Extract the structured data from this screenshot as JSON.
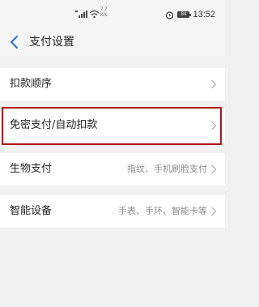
{
  "status_bar": {
    "net_speed_value": "7.7",
    "net_speed_unit": "K/s",
    "battery": "84",
    "time": "13:52"
  },
  "header": {
    "title": "支付设置"
  },
  "rows": [
    {
      "label": "扣款顺序",
      "value": ""
    },
    {
      "label": "免密支付/自动扣款",
      "value": ""
    },
    {
      "label": "生物支付",
      "value": "指纹、手机刷脸支付"
    },
    {
      "label": "智能设备",
      "value": "手表、手环、智能卡等"
    }
  ],
  "colors": {
    "highlight_border": "#b0161c",
    "page_background": "#f1f1f1",
    "row_background": "#ffffff"
  },
  "icons": [
    "back-arrow-icon",
    "chevron-right-icon",
    "signal-icon",
    "wifi-icon",
    "alarm-icon",
    "battery-icon"
  ]
}
